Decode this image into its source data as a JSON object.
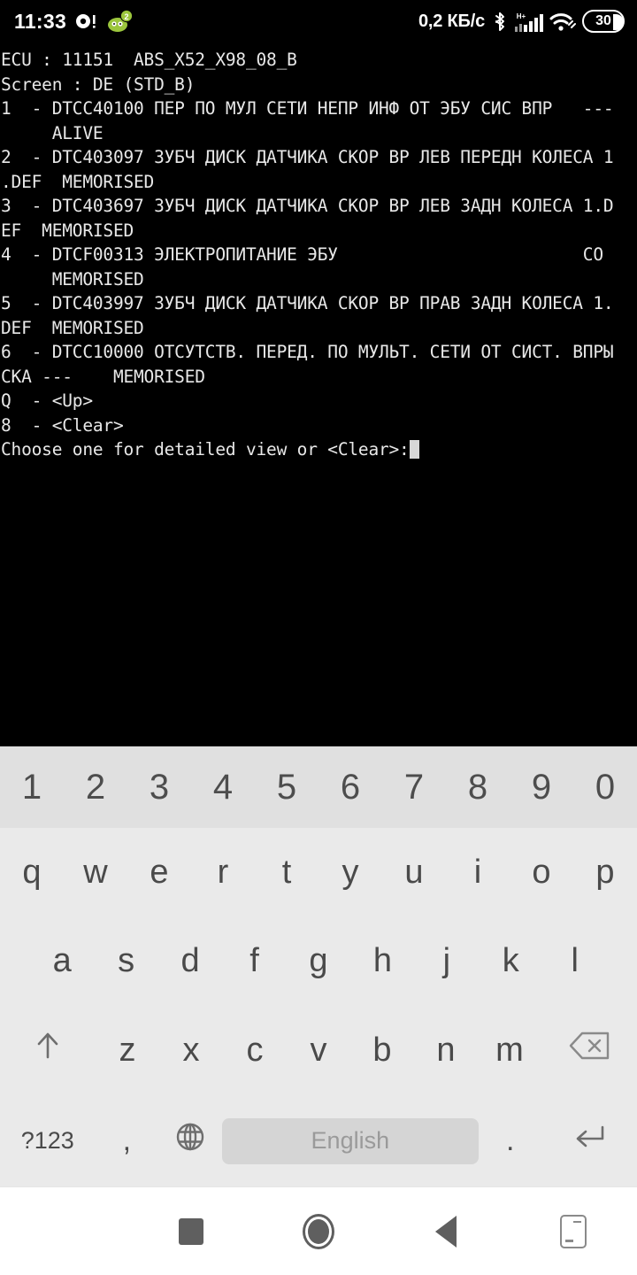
{
  "statusbar": {
    "clock": "11:33",
    "icons_left": [
      "camera-alert-icon",
      "green-character-badge-icon"
    ],
    "badge_count": "2",
    "network_speed": "0,2 КБ/с",
    "icons_right": [
      "bluetooth-icon",
      "hplus-signal-icon",
      "wifi-icon"
    ],
    "signal_label": "H+",
    "battery_level": "30"
  },
  "terminal": {
    "background_color": "#000000",
    "text_color": "#e8e8e8",
    "lines": [
      "ECU : 11151  ABS_X52_X98_08_B",
      "Screen : DE (STD_B)",
      "1  - DTCC40100 ПЕР ПО МУЛ СЕТИ НЕПР ИНФ ОТ ЭБУ СИС ВПР   ---",
      "     ALIVE",
      "2  - DTC403097 ЗУБЧ ДИСК ДАТЧИКА СКОР ВР ЛЕВ ПЕРЕДН КОЛЕСА 1",
      ".DEF  MEMORISED",
      "3  - DTC403697 ЗУБЧ ДИСК ДАТЧИКА СКОР ВР ЛЕВ ЗАДН КОЛЕСА 1.D",
      "EF  MEMORISED",
      "4  - DTCF00313 ЭЛЕКТРОПИТАНИЕ ЭБУ                        CO",
      "     MEMORISED",
      "5  - DTC403997 ЗУБЧ ДИСК ДАТЧИКА СКОР ВР ПРАВ ЗАДН КОЛЕСА 1.",
      "DEF  MEMORISED",
      "6  - DTCC10000 ОТСУТСТВ. ПЕРЕД. ПО МУЛЬТ. СЕТИ ОТ СИСТ. ВПРЫ",
      "СКА ---    MEMORISED",
      "Q  - <Up>",
      "8  - <Clear>"
    ],
    "prompt": "Choose one for detailed view or <Clear>:",
    "cursor_visible": true
  },
  "keyboard": {
    "background_color": "#eaeaea",
    "numrow_background_color": "#e0e0e0",
    "rows": {
      "numbers": [
        "1",
        "2",
        "3",
        "4",
        "5",
        "6",
        "7",
        "8",
        "9",
        "0"
      ],
      "top": [
        "q",
        "w",
        "e",
        "r",
        "t",
        "y",
        "u",
        "i",
        "o",
        "p"
      ],
      "home": [
        "a",
        "s",
        "d",
        "f",
        "g",
        "h",
        "j",
        "k",
        "l"
      ],
      "bottom": [
        "z",
        "x",
        "c",
        "v",
        "b",
        "n",
        "m"
      ]
    },
    "shift_key": "shift-up-arrow-icon",
    "backspace_key": "backspace-icon",
    "symbols_key": "?123",
    "comma_key": ",",
    "language_key": "globe-icon",
    "space_key": "English",
    "period_key": ".",
    "enter_key": "enter-arrow-icon"
  },
  "navbar": {
    "background_color": "#ffffff",
    "buttons": [
      "recents-square-icon",
      "home-circle-icon",
      "back-triangle-icon",
      "screenshot-frame-icon"
    ]
  }
}
